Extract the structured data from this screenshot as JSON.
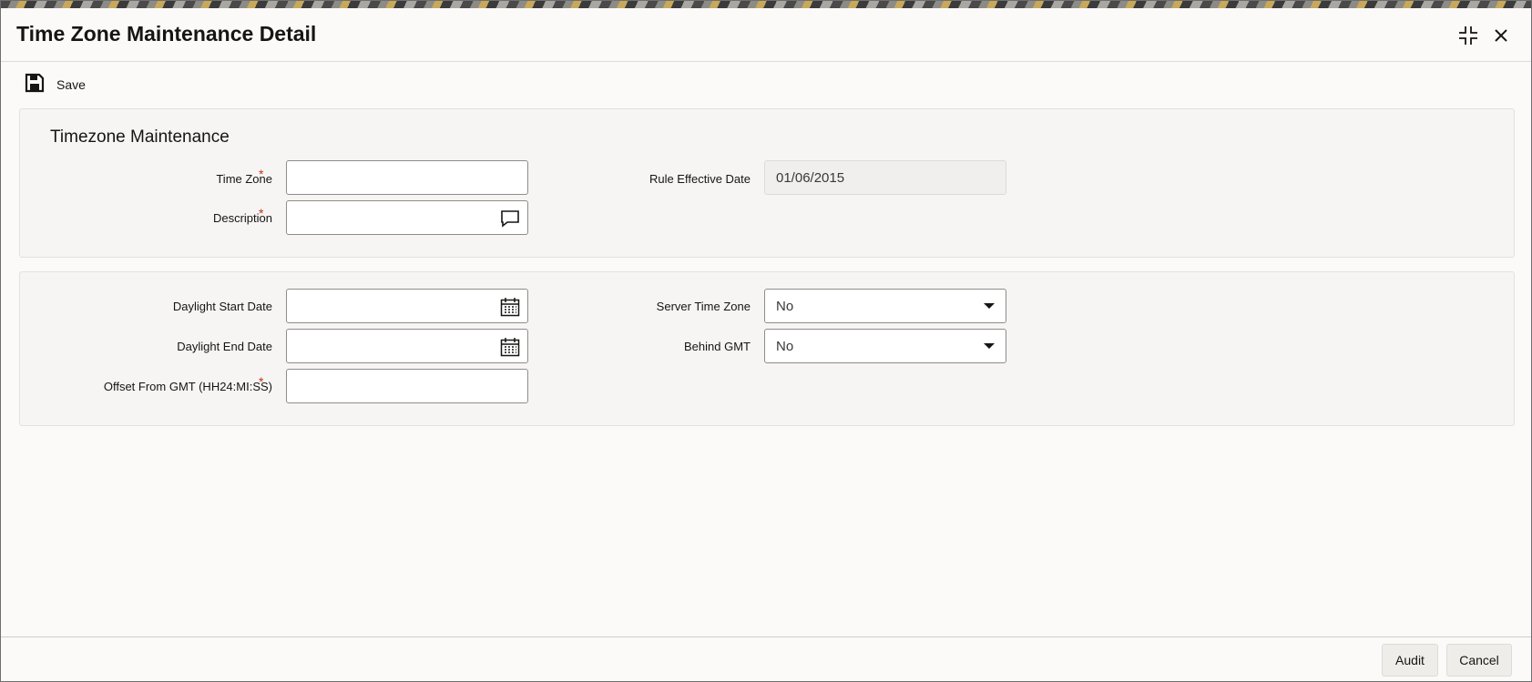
{
  "window": {
    "title": "Time Zone Maintenance Detail",
    "maximize_icon": "collapse-icon",
    "close_icon": "close-icon"
  },
  "toolbar": {
    "save_label": "Save",
    "save_icon": "save-icon"
  },
  "section1": {
    "title": "Timezone Maintenance",
    "time_zone_label": "Time Zone",
    "time_zone_value": "",
    "description_label": "Description",
    "description_value": "",
    "description_icon": "comment-icon",
    "rule_effective_date_label": "Rule Effective Date",
    "rule_effective_date_value": "01/06/2015",
    "required_marker": "*"
  },
  "section2": {
    "daylight_start_label": "Daylight Start Date",
    "daylight_start_value": "",
    "daylight_end_label": "Daylight End Date",
    "daylight_end_value": "",
    "offset_label": "Offset From GMT (HH24:MI:SS)",
    "offset_value": "",
    "server_time_zone_label": "Server Time Zone",
    "server_time_zone_value": "No",
    "behind_gmt_label": "Behind GMT",
    "behind_gmt_value": "No",
    "calendar_icon": "calendar-icon",
    "required_marker": "*"
  },
  "footer": {
    "audit_label": "Audit",
    "cancel_label": "Cancel"
  },
  "colors": {
    "required": "#c2331c",
    "background": "#fbfaf9",
    "panel": "#f6f5f3"
  }
}
